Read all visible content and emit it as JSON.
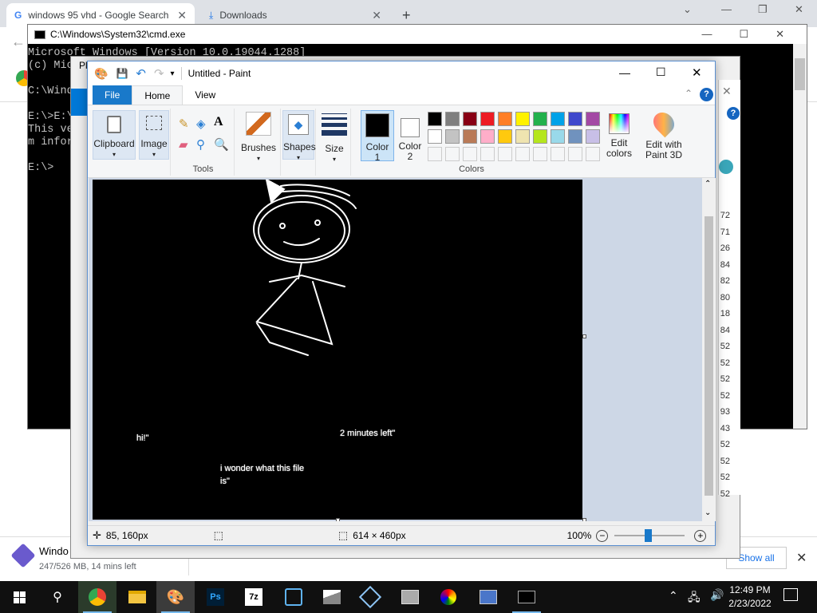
{
  "chrome": {
    "tabs": [
      {
        "title": "windows 95 vhd - Google Search"
      },
      {
        "title": "Downloads"
      }
    ],
    "new_tab": "+",
    "download": {
      "name": "Windo",
      "status": "247/526 MB, 14 mins left"
    },
    "show_all": "Show all"
  },
  "cmd": {
    "title": "C:\\Windows\\System32\\cmd.exe",
    "lines": [
      "Microsoft Windows [Version 10.0.19044.1288]",
      "(c) Mic",
      "",
      "C:\\Wind",
      "",
      "E:\\>E:\\",
      "This ve                                                                                 's syste",
      "m infor",
      "",
      "E:\\>"
    ],
    "text": "Microsoft Windows [Version 10.0.19044.1288]\n(c) Mic\n\nC:\\Wind\n\nE:\\>E:\\\nThis ve                                                                                    's syste\nm infor\n\nE:\\>"
  },
  "bg_window": {
    "title_fragment": "Pl",
    "right_numbers": [
      "72",
      "71",
      "26",
      "84",
      "82",
      "80",
      "18",
      "84",
      "52",
      "52",
      "52",
      "52",
      "93",
      "43",
      "52",
      "52",
      "52",
      "52"
    ]
  },
  "paint": {
    "title": "Untitled - Paint",
    "menu": {
      "file": "File",
      "home": "Home",
      "view": "View"
    },
    "ribbon": {
      "clipboard": "Clipboard",
      "image": "Image",
      "tools": "Tools",
      "brushes": "Brushes",
      "shapes": "Shapes",
      "size": "Size",
      "color1": "Color\n1",
      "color1_a": "Color",
      "color1_b": "1",
      "color2_a": "Color",
      "color2_b": "2",
      "colors": "Colors",
      "edit_colors_a": "Edit",
      "edit_colors_b": "colors",
      "paint3d_a": "Edit with",
      "paint3d_b": "Paint 3D"
    },
    "palette_row1": [
      "#000000",
      "#7f7f7f",
      "#880015",
      "#ed1c24",
      "#ff7f27",
      "#fff200",
      "#22b14c",
      "#00a2e8",
      "#3f48cc",
      "#a349a4"
    ],
    "palette_row2": [
      "#ffffff",
      "#c3c3c3",
      "#b97a57",
      "#ffaec9",
      "#ffc90e",
      "#efe4b0",
      "#b5e61d",
      "#99d9ea",
      "#7092be",
      "#c8bfe7"
    ],
    "canvas_text": {
      "hi": "hi!\"",
      "minutes": "2 minutes left\"",
      "wonder1": "i wonder what this file",
      "wonder2": "is\""
    },
    "status": {
      "position": "85, 160px",
      "size": "614 × 460px",
      "zoom": "100%"
    }
  },
  "taskbar": {
    "time": "12:49 PM",
    "date": "2/23/2022"
  }
}
